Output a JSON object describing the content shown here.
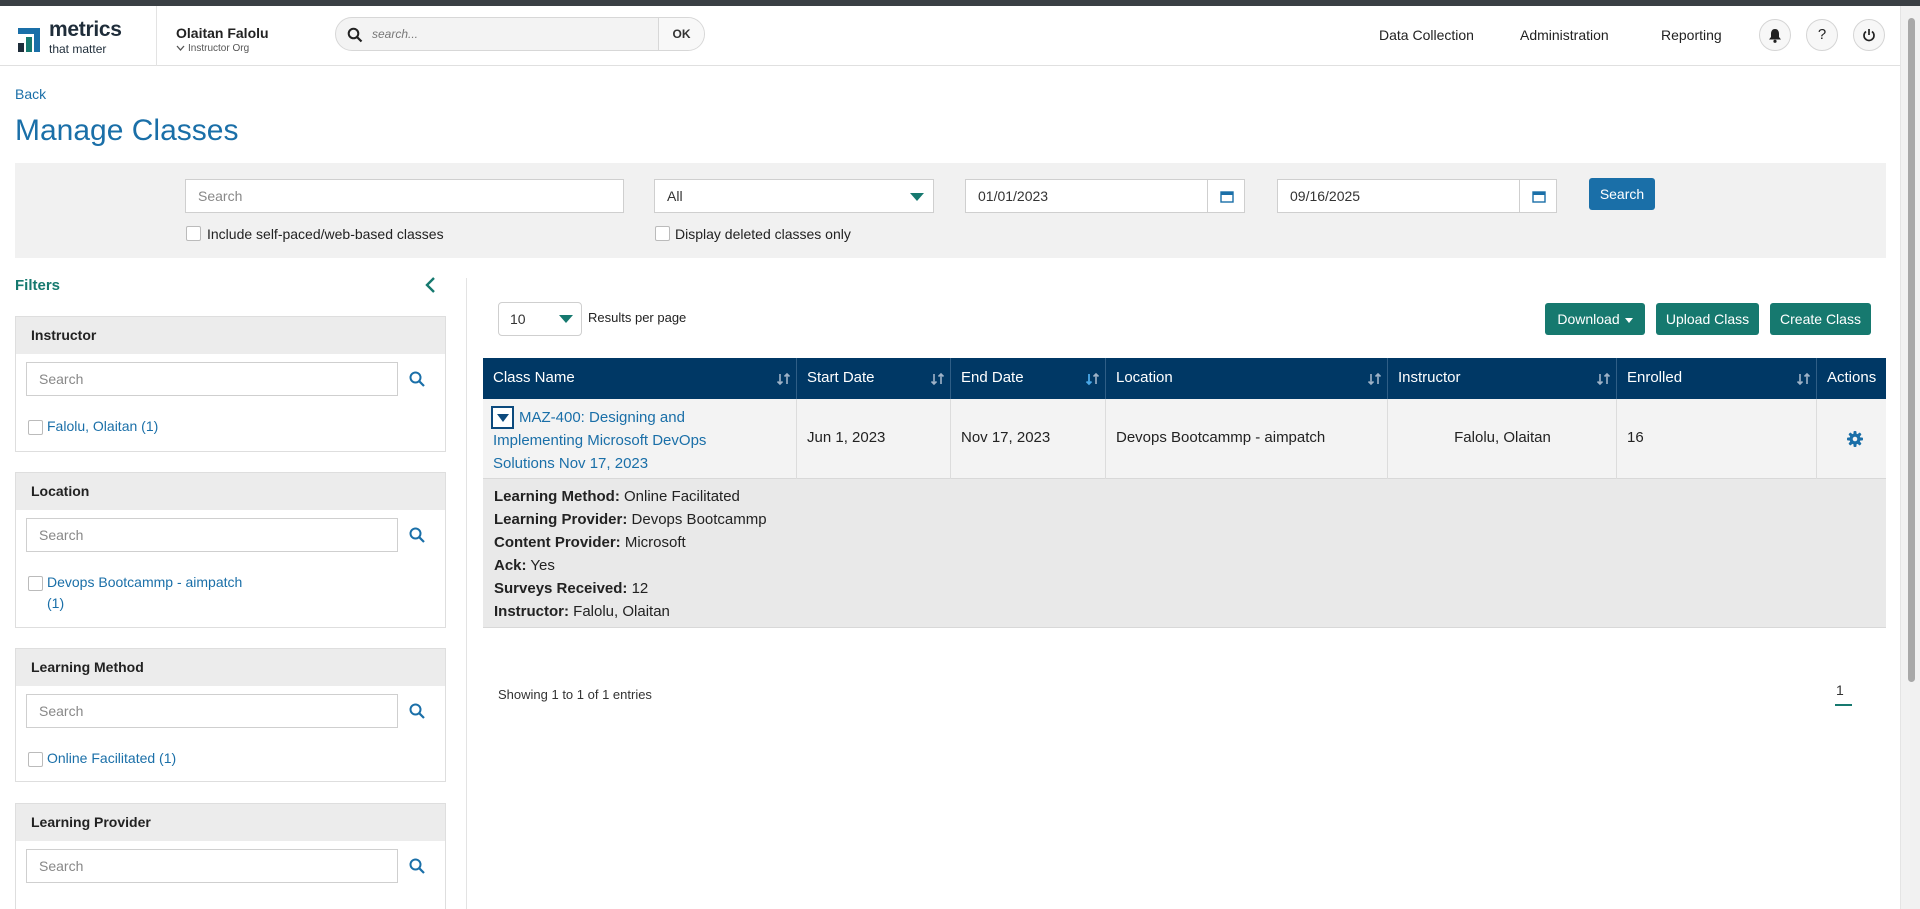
{
  "header": {
    "logo": {
      "title": "metrics",
      "subtitle": "that matter"
    },
    "user": {
      "name": "Olaitan Falolu",
      "org": "Instructor Org"
    },
    "search": {
      "placeholder": "search...",
      "ok_label": "OK"
    },
    "nav": [
      "Data Collection",
      "Administration",
      "Reporting"
    ],
    "icons": [
      "bell-icon",
      "help-icon",
      "power-icon"
    ]
  },
  "page": {
    "back_label": "Back",
    "title": "Manage Classes"
  },
  "filterbar": {
    "search_placeholder": "Search",
    "status_value": "All",
    "start_date": "01/01/2023",
    "end_date": "09/16/2025",
    "search_button": "Search",
    "include_self_paced": "Include self-paced/web-based classes",
    "display_deleted": "Display deleted classes only"
  },
  "filters": {
    "title": "Filters",
    "groups": [
      {
        "name": "Instructor",
        "placeholder": "Search",
        "options": [
          "Falolu, Olaitan (1)"
        ]
      },
      {
        "name": "Location",
        "placeholder": "Search",
        "options": [
          "Devops Bootcammp - aimpatch (1)"
        ]
      },
      {
        "name": "Learning Method",
        "placeholder": "Search",
        "options": [
          "Online Facilitated (1)"
        ]
      },
      {
        "name": "Learning Provider",
        "placeholder": "Search",
        "options": []
      }
    ]
  },
  "toolbar": {
    "results_per_page": "10",
    "results_label": "Results per page",
    "download": "Download",
    "upload": "Upload Class",
    "create": "Create Class"
  },
  "table": {
    "columns": [
      "Class Name",
      "Start Date",
      "End Date",
      "Location",
      "Instructor",
      "Enrolled",
      "Actions"
    ],
    "rows": [
      {
        "class_name": "MAZ-400: Designing and Implementing Microsoft DevOps Solutions Nov 17, 2023",
        "start_date": "Jun 1, 2023",
        "end_date": "Nov 17, 2023",
        "location": "Devops Bootcammp - aimpatch",
        "instructor": "Falolu, Olaitan",
        "enrolled": "16",
        "details": [
          {
            "label": "Learning Method:",
            "value": "Online Facilitated"
          },
          {
            "label": "Learning Provider:",
            "value": "Devops Bootcammp"
          },
          {
            "label": "Content Provider:",
            "value": "Microsoft"
          },
          {
            "label": "Ack:",
            "value": "Yes"
          },
          {
            "label": "Surveys Received:",
            "value": "12"
          },
          {
            "label": "Instructor:",
            "value": "Falolu, Olaitan"
          }
        ]
      }
    ]
  },
  "footer": {
    "showing": "Showing 1 to 1 of 1 entries",
    "page": "1"
  },
  "colors": {
    "primary_blue": "#1a6fa8",
    "table_header": "#003865",
    "accent_green": "#16796f"
  }
}
